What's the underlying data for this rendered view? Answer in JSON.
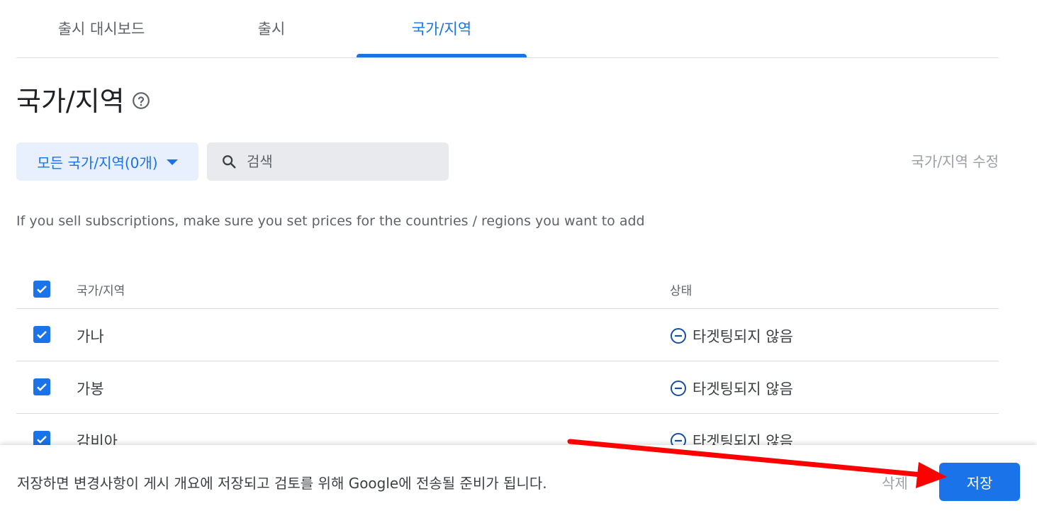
{
  "tabs": [
    {
      "label": "출시 대시보드"
    },
    {
      "label": "출시"
    },
    {
      "label": "국가/지역"
    }
  ],
  "page": {
    "title": "국가/지역"
  },
  "filter": {
    "label": "모든 국가/지역(0개)"
  },
  "search": {
    "placeholder": "검색"
  },
  "edit_link": "국가/지역 수정",
  "info_text": "If you sell subscriptions, make sure you set prices for the countries / regions you want to add",
  "table": {
    "headers": {
      "country": "국가/지역",
      "status": "상태"
    },
    "rows": [
      {
        "country": "가나",
        "status": "타겟팅되지 않음"
      },
      {
        "country": "가봉",
        "status": "타겟팅되지 않음"
      },
      {
        "country": "감비아",
        "status": "타겟팅되지 않음"
      }
    ]
  },
  "bottom_bar": {
    "message": "저장하면 변경사항이 게시 개요에 저장되고 검토를 위해 Google에 전송될 준비가 됩니다.",
    "delete_label": "삭제",
    "save_label": "저장"
  },
  "colors": {
    "accent": "#1a73e8",
    "annotation_arrow": "#ff0000"
  }
}
